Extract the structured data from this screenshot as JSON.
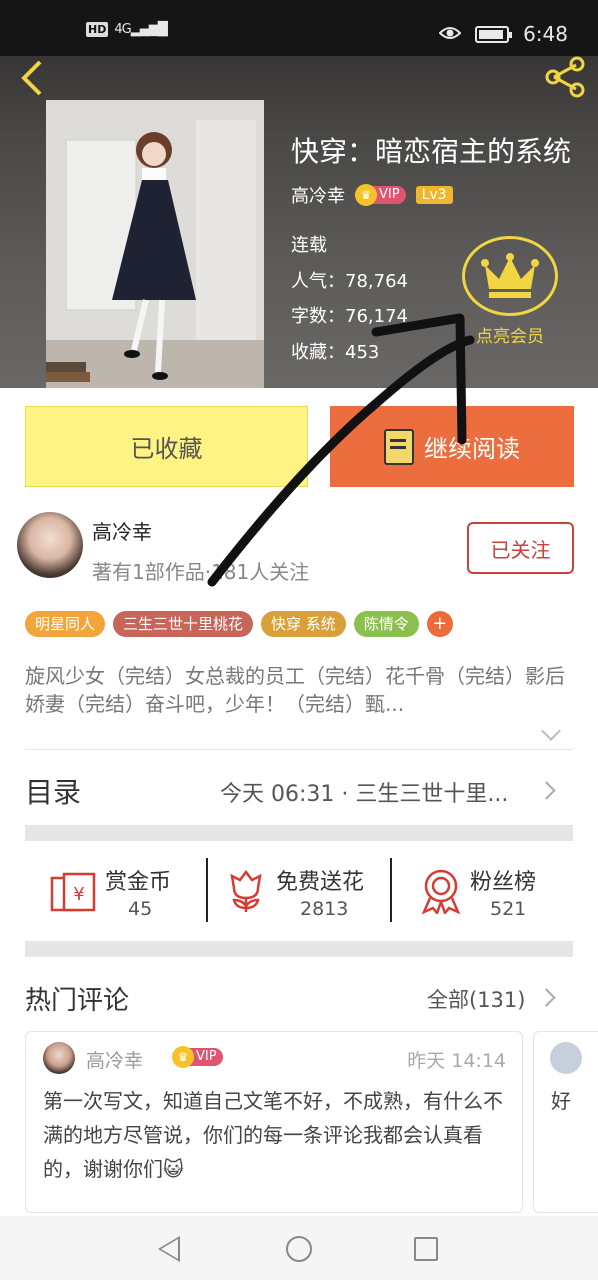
{
  "status_bar": {
    "network": "HD",
    "signal": "4G",
    "time": "6:48"
  },
  "book": {
    "title": "快穿：暗恋宿主的系统",
    "author": "高冷幸",
    "vip_label": "VIP",
    "level": "Lv3",
    "status": "连载",
    "popularity": "人气：78,764",
    "word_count": "字数：76,174",
    "favorites": "收藏：453"
  },
  "member": {
    "label": "点亮会员"
  },
  "actions": {
    "collected_label": "已收藏",
    "read_label": "继续阅读"
  },
  "author_info": {
    "name": "高冷幸",
    "meta": "著有1部作品·181人关注",
    "follow_label": "已关注"
  },
  "tags": [
    {
      "label": "明星同人",
      "color": "#f3a43a"
    },
    {
      "label": "三生三世十里桃花",
      "color": "#c8655a"
    },
    {
      "label": "快穿  系统",
      "color": "#d9a03a"
    },
    {
      "label": "陈情令",
      "color": "#8bbf4e"
    }
  ],
  "description": "旋风少女（完结）女总裁的员工（完结）花千骨（完结）影后娇妻（完结）奋斗吧，少年！（完结）甄...",
  "toc": {
    "title": "目录",
    "latest": "今天 06:31 · 三生三世十里..."
  },
  "rewards": [
    {
      "label": "赏金币",
      "count": "45",
      "icon": "coin-envelope-icon"
    },
    {
      "label": "免费送花",
      "count": "2813",
      "icon": "flower-icon"
    },
    {
      "label": "粉丝榜",
      "count": "521",
      "icon": "medal-icon"
    }
  ],
  "comments_section": {
    "title": "热门评论",
    "all_label": "全部(131)"
  },
  "comments": [
    {
      "name": "高冷幸",
      "vip": "VIP",
      "time": "昨天 14:14",
      "text": "第一次写文，知道自己文笔不好，不成熟，有什么不满的地方尽管说，你们的每一条评论我都会认真看的，谢谢你们😺"
    },
    {
      "text": "好"
    }
  ],
  "colors": {
    "accent_orange": "#ec6d3e",
    "collected_yellow": "#fff384",
    "gold": "#f1d542",
    "follow_red": "#c8413a"
  }
}
